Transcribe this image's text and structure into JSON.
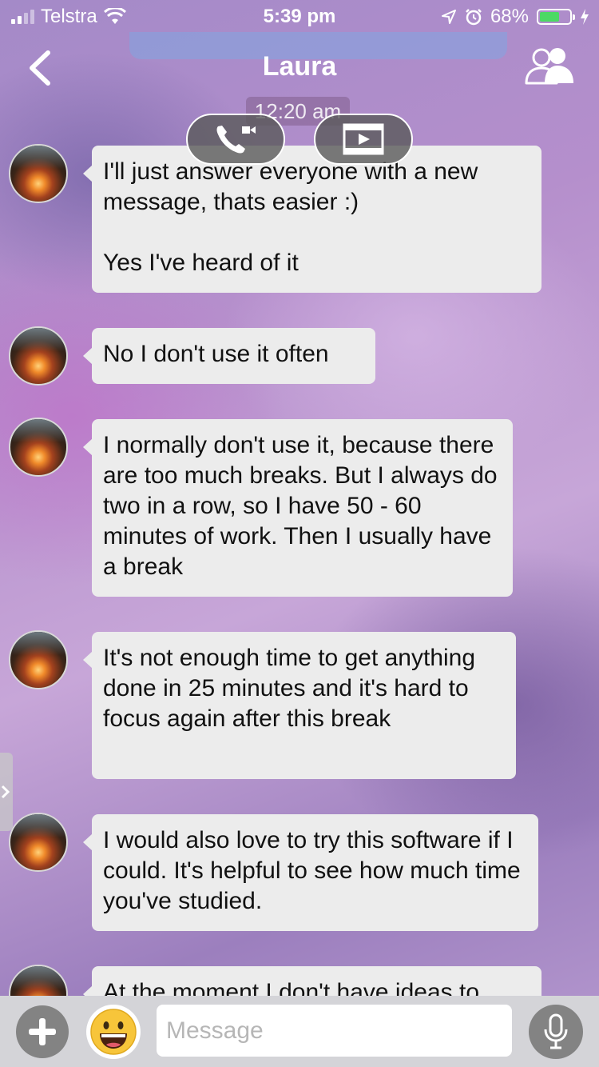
{
  "status_bar": {
    "carrier": "Telstra",
    "time": "5:39 pm",
    "battery_percent": "68%",
    "battery_level": 0.68,
    "icons": [
      "signal-icon",
      "wifi-icon",
      "location-icon",
      "alarm-icon",
      "battery-icon",
      "charging-icon"
    ]
  },
  "header": {
    "title": "Laura",
    "timestamp": "12:20 am",
    "icons": [
      "back-icon",
      "group-icon",
      "phone-icon",
      "video-icon"
    ]
  },
  "messages": [
    {
      "text": "I'll just answer everyone with a new message, thats easier :)\n\nYes I've heard of it"
    },
    {
      "text": "No I don't use it often"
    },
    {
      "text": "I normally don't use it, because there are too much breaks. But I always do two in a row, so I have 50 - 60 minutes of work. Then I usually have a break"
    },
    {
      "text": "It's not enough time to get anything done in 25 minutes and it's hard to focus again after this break"
    },
    {
      "text": "I would also love to try this software if I could. It's helpful to see how much time you've studied."
    },
    {
      "text": "At the moment I don't have ideas to"
    }
  ],
  "input_bar": {
    "placeholder": "Message",
    "value": "",
    "icons": [
      "plus-icon",
      "emoji-icon",
      "microphone-icon"
    ]
  }
}
